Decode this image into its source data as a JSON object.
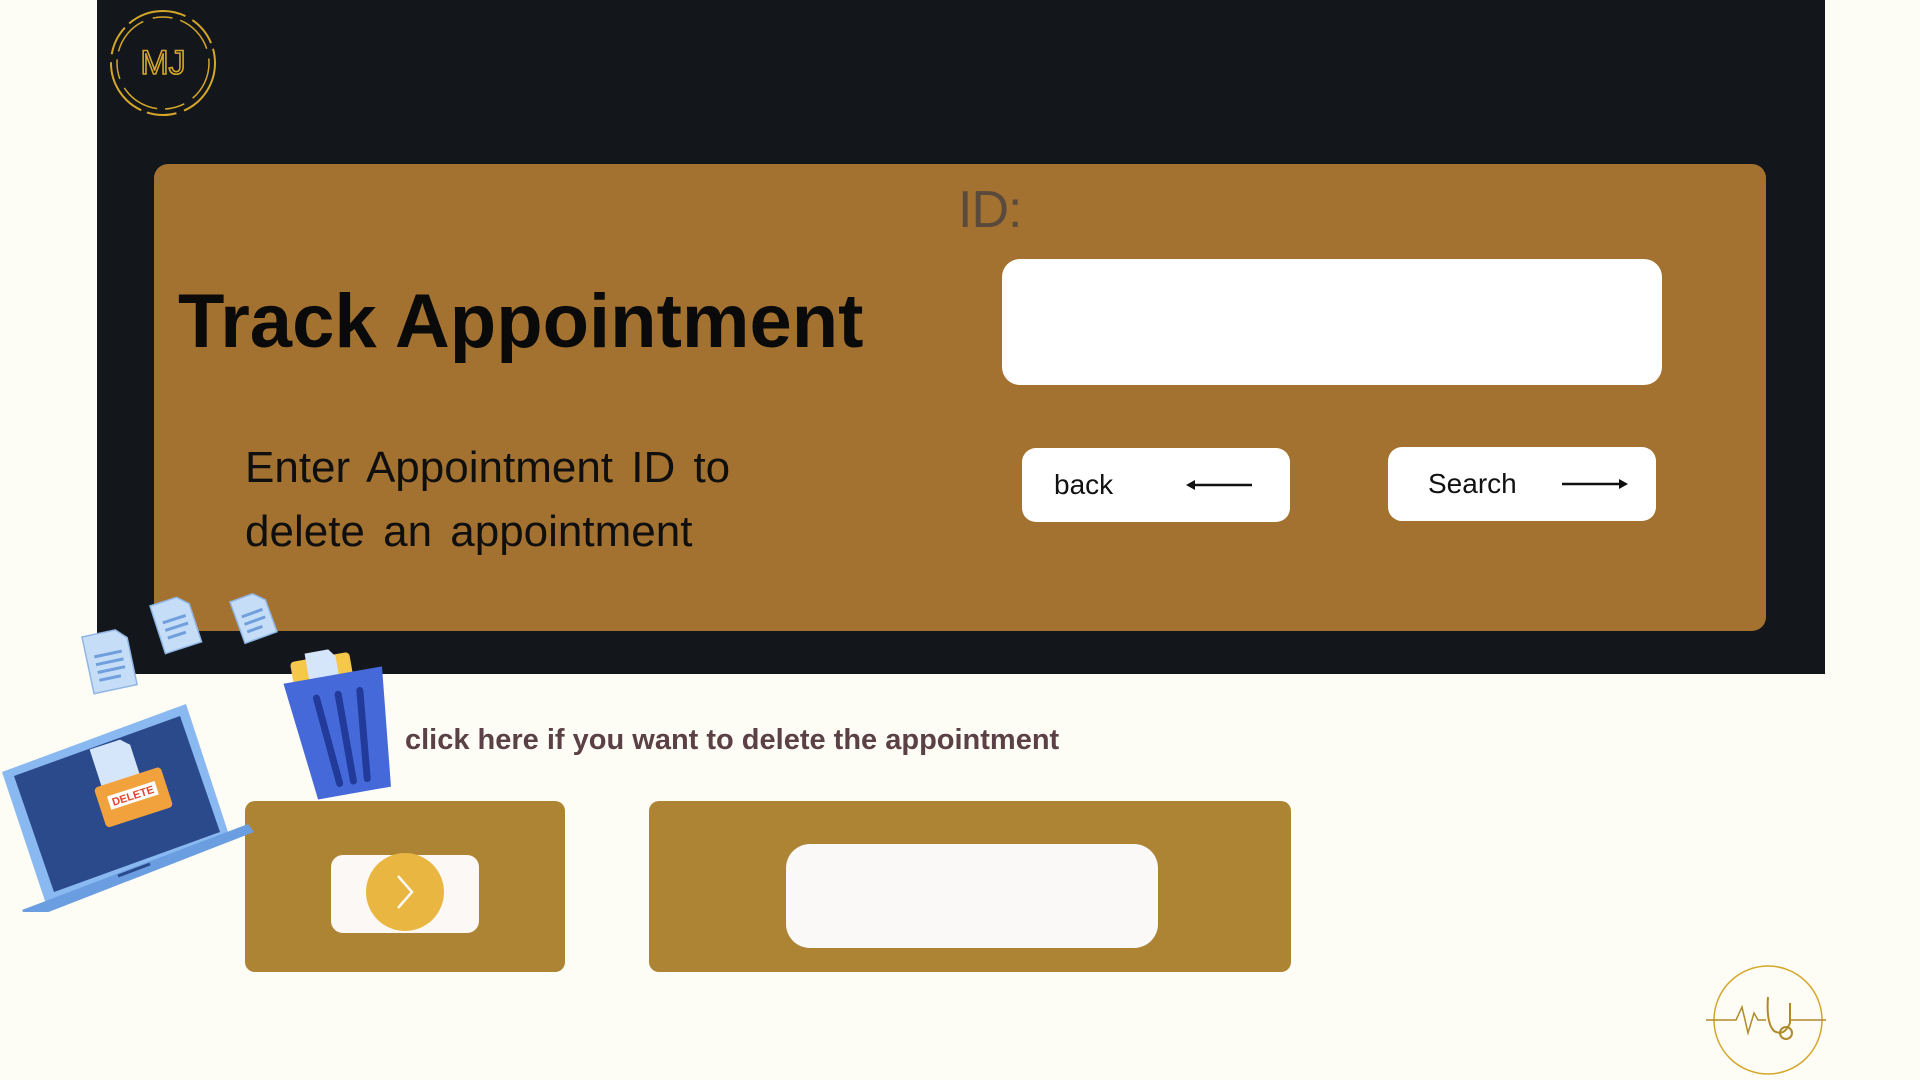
{
  "header": {
    "logo_text": "MJ"
  },
  "form": {
    "id_label": "ID:",
    "title": "Track Appointment",
    "instructions": "Enter  Appointment  ID to delete an  appointment",
    "id_value": "",
    "back_label": "back",
    "search_label": "Search"
  },
  "delete_section": {
    "hint": "click here if you want to delete the appointment",
    "field_value": ""
  },
  "illustration": {
    "badge_text": "DELETE"
  },
  "colors": {
    "page_bg": "#fdfcf5",
    "header_bg": "#13171b",
    "card_bg": "#a47230",
    "panel_bg": "#ad8433",
    "accent_gold": "#e9b741",
    "logo_gold": "#d4a62a"
  },
  "icons": {
    "logo": "mj-monogram-icon",
    "back_arrow": "arrow-left-icon",
    "search_arrow": "arrow-right-icon",
    "toggle": "chevron-right-icon",
    "bottom_logo": "stethoscope-heartbeat-icon"
  }
}
